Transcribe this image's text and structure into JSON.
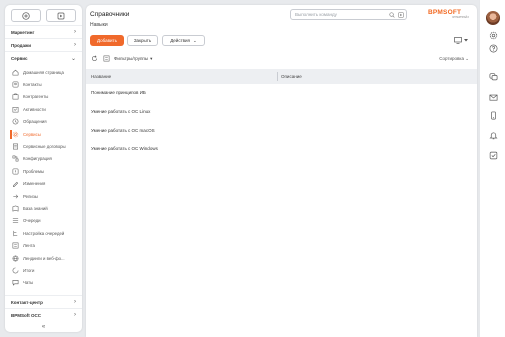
{
  "sidebar": {
    "groups_top": [
      {
        "label": "Маркетинг"
      },
      {
        "label": "Продажи"
      },
      {
        "label": "Сервис"
      }
    ],
    "items": [
      {
        "label": "Домашняя страница",
        "icon": "home-icon"
      },
      {
        "label": "Контакты",
        "icon": "contact-icon"
      },
      {
        "label": "Контрагенты",
        "icon": "accounts-icon"
      },
      {
        "label": "Активности",
        "icon": "activity-icon"
      },
      {
        "label": "Обращения",
        "icon": "case-icon"
      },
      {
        "label": "Сервисы",
        "icon": "service-gear-icon",
        "active": true
      },
      {
        "label": "Сервисные договоры",
        "icon": "contract-icon"
      },
      {
        "label": "Конфигурация",
        "icon": "config-icon"
      },
      {
        "label": "Проблемы",
        "icon": "problem-icon"
      },
      {
        "label": "Изменения",
        "icon": "change-icon"
      },
      {
        "label": "Релизы",
        "icon": "release-icon"
      },
      {
        "label": "База знаний",
        "icon": "knowledge-icon"
      },
      {
        "label": "Очереди",
        "icon": "queue-icon"
      },
      {
        "label": "Настройка очередей",
        "icon": "queue-settings-icon"
      },
      {
        "label": "Лента",
        "icon": "feed-icon"
      },
      {
        "label": "Лендинги и веб-фо...",
        "icon": "landing-icon"
      },
      {
        "label": "Итоги",
        "icon": "dashboard-icon"
      },
      {
        "label": "Чаты",
        "icon": "chat-icon"
      }
    ],
    "groups_bottom": [
      {
        "label": "Контакт-центр"
      },
      {
        "label": "BPMSoft ОСС"
      }
    ],
    "collapse_glyph": "«"
  },
  "header": {
    "title": "Справочники",
    "subtitle": "Навыки",
    "command_placeholder": "Выполнить команду",
    "logo": "BPMSOFT",
    "logo_sub": "ЭНТЕРПРАЙЗ"
  },
  "actions": {
    "add": "Добавить",
    "close": "Закрыть",
    "actions": "Действия"
  },
  "toolbar": {
    "filters": "Фильтры/группы",
    "sorting": "Сортировка"
  },
  "table": {
    "columns": [
      "Название",
      "Описание"
    ],
    "rows": [
      {
        "name": "Понимание принципов ИБ",
        "description": ""
      },
      {
        "name": "Умение работать с ОС Linux",
        "description": ""
      },
      {
        "name": "Умение работать с ОС macOS",
        "description": ""
      },
      {
        "name": "Умение работать с ОС Windows",
        "description": ""
      }
    ]
  },
  "colors": {
    "accent": "#f0692b",
    "logo": "#f26a23",
    "header_bg": "#edeff2",
    "page_bg": "#e8eaed"
  }
}
